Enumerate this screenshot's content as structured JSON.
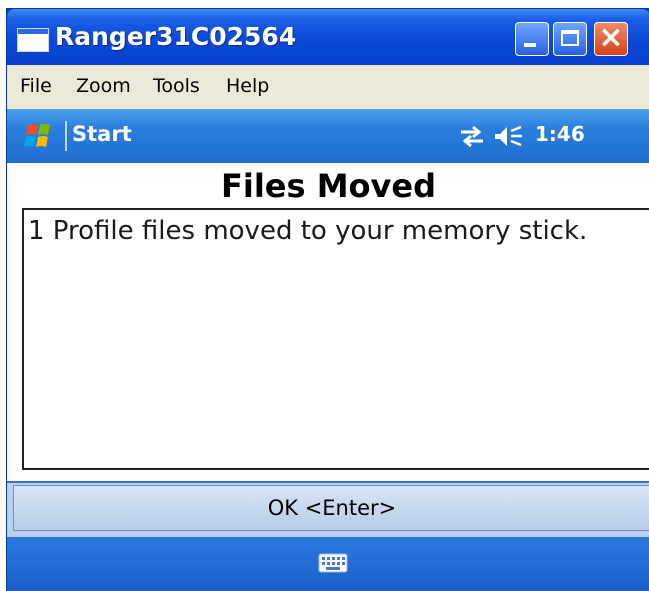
{
  "window": {
    "title": "Ranger31C02564"
  },
  "menubar": {
    "items": [
      "File",
      "Zoom",
      "Tools",
      "Help"
    ]
  },
  "startbar": {
    "start_label": "Start",
    "clock": "1:46",
    "icons": [
      "windows-logo-icon",
      "connectivity-icon",
      "volume-icon"
    ]
  },
  "dialog": {
    "heading": "Files Moved",
    "message": "1 Profile files moved to your memory stick.",
    "ok_label": "OK <Enter>"
  },
  "bottombar": {
    "icons": [
      "keyboard-icon"
    ]
  },
  "colors": {
    "titlebar": "#0a4ad6",
    "menubar": "#ece9d8",
    "startbar": "#2b7fdc",
    "close_button": "#d64218",
    "ok_bar": "#b9d1ec"
  }
}
